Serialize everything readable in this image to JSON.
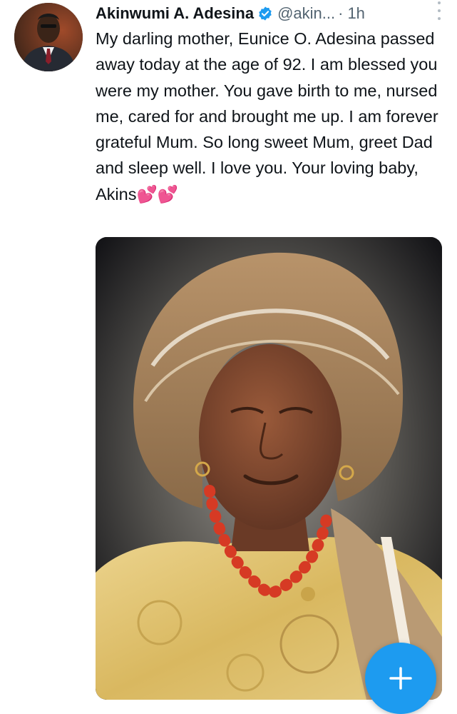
{
  "tweet": {
    "author": {
      "display_name": "Akinwumi A. Adesina",
      "handle": "@akin...",
      "verified": true
    },
    "separator": "·",
    "timestamp": "1h",
    "text": "My darling mother, Eunice O. Adesina passed away today at the age of 92. I am blessed you were my mother. You gave birth to me, nursed me, cared for and brought me up. I am forever grateful Mum. So long sweet Mum, greet Dad and sleep well. I love you. Your loving baby, Akins💕💕"
  },
  "colors": {
    "accent": "#1d9bf0",
    "text_primary": "#0f1419",
    "text_secondary": "#536471"
  },
  "icons": {
    "verified": "verified-badge-icon",
    "more": "more-vertical-icon",
    "compose": "plus-icon"
  }
}
